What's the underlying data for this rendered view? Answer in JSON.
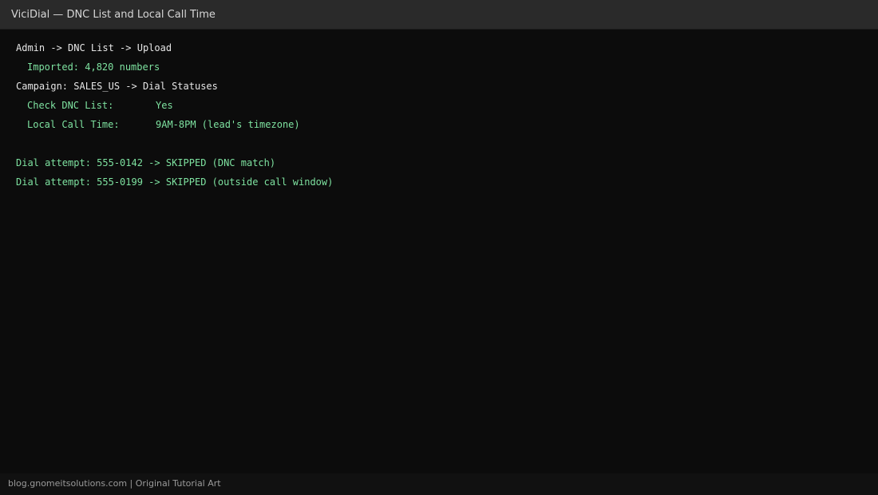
{
  "window": {
    "title": "ViciDial — DNC List and Local Call Time"
  },
  "terminal": {
    "breadcrumb_upload": "Admin -> DNC List -> Upload",
    "imported": "Imported: 4,820 numbers",
    "breadcrumb_campaign": "Campaign: SALES_US -> Dial Statuses",
    "check_dnc": {
      "label": "Check DNC List:",
      "value": "Yes"
    },
    "local_call_time": {
      "label": "Local Call Time:",
      "value": "9AM-8PM (lead's timezone)"
    },
    "dial_attempts": [
      "Dial attempt: 555-0142 -> SKIPPED (DNC match)",
      "Dial attempt: 555-0199 -> SKIPPED (outside call window)"
    ]
  },
  "footer": {
    "credit": "blog.gnomeitsolutions.com | Original Tutorial Art"
  },
  "colors": {
    "background": "#0c0c0c",
    "titlebar": "#2a2a2a",
    "text_white": "#e6e6e6",
    "text_green": "#7ee2a0"
  }
}
